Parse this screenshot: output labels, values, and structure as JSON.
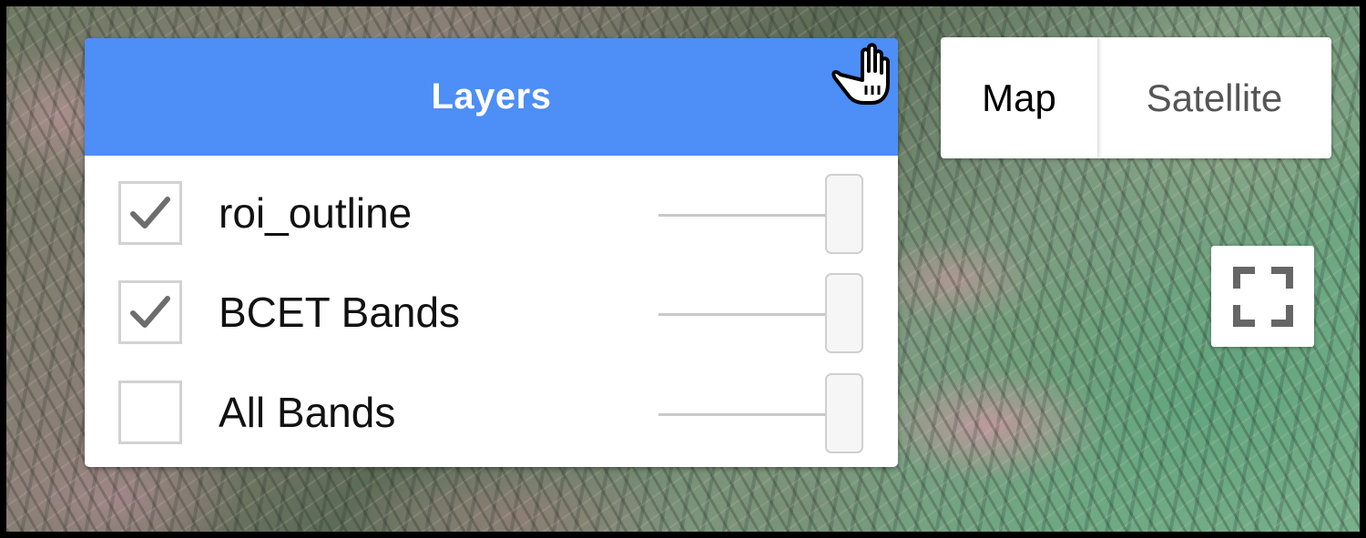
{
  "layers_panel": {
    "title": "Layers",
    "items": [
      {
        "label": "roi_outline",
        "checked": true,
        "opacity": 1.0
      },
      {
        "label": "BCET Bands",
        "checked": true,
        "opacity": 1.0
      },
      {
        "label": "All Bands",
        "checked": false,
        "opacity": 1.0
      }
    ]
  },
  "map_type": {
    "map_label": "Map",
    "satellite_label": "Satellite",
    "selected": "Map"
  },
  "controls": {
    "fullscreen_icon": "fullscreen-icon",
    "cursor_icon": "hand-cursor-icon"
  },
  "colors": {
    "header": "#4d8ef7",
    "checkmark": "#6d6d6d"
  }
}
